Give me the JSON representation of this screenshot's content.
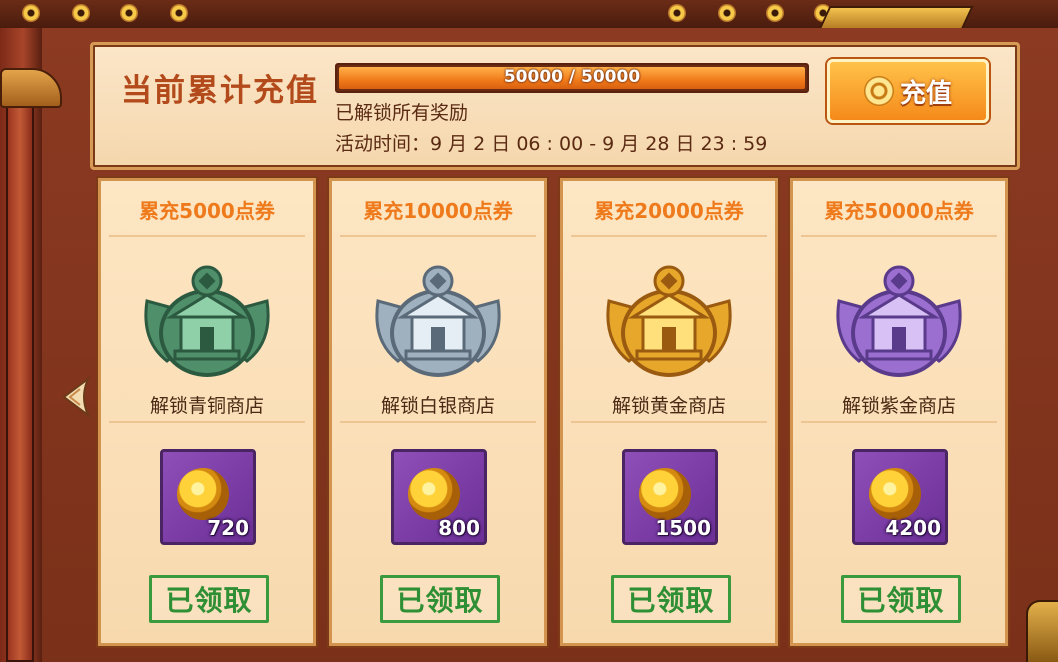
{
  "header": {
    "title": "当前累计充值",
    "progress_text": "50000 / 50000",
    "progress_fraction": 1.0,
    "status_text": "已解锁所有奖励",
    "time_text": "活动时间：9 月 2 日 06 : 00 - 9 月 28 日 23 : 59",
    "recharge_button": "充值"
  },
  "cards": [
    {
      "title": "累充5000点券",
      "shop": "解锁青铜商店",
      "item_count": "720",
      "claim_status": "已领取",
      "badge_color": "#4f8f6a",
      "badge_light": "#8fd0a8",
      "badge_dark": "#2c5a40"
    },
    {
      "title": "累充10000点券",
      "shop": "解锁白银商店",
      "item_count": "800",
      "claim_status": "已领取",
      "badge_color": "#9fb0bf",
      "badge_light": "#e6eef5",
      "badge_dark": "#5b6a78"
    },
    {
      "title": "累充20000点券",
      "shop": "解锁黄金商店",
      "item_count": "1500",
      "claim_status": "已领取",
      "badge_color": "#e6a72a",
      "badge_light": "#ffe07a",
      "badge_dark": "#9a5a10"
    },
    {
      "title": "累充50000点券",
      "shop": "解锁紫金商店",
      "item_count": "4200",
      "claim_status": "已领取",
      "badge_color": "#9b6fd0",
      "badge_light": "#d8c2f5",
      "badge_dark": "#5a3a8a"
    }
  ]
}
